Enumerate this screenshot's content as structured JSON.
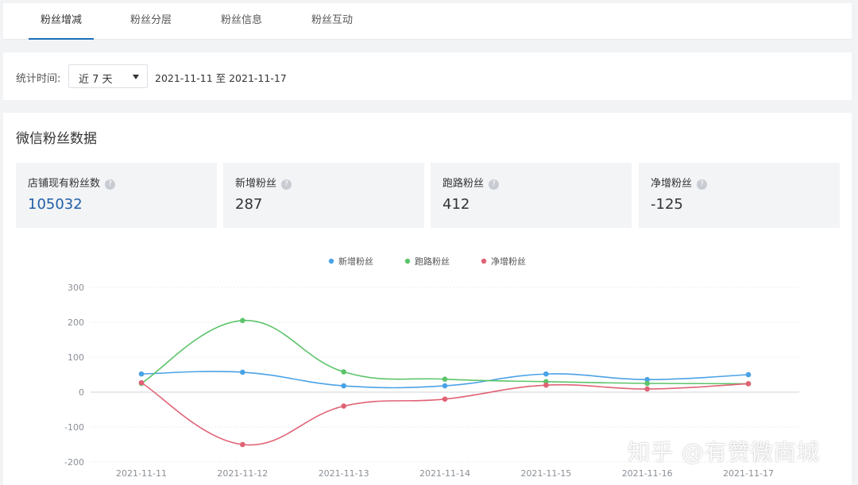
{
  "tabs": [
    {
      "label": "粉丝增减",
      "active": true
    },
    {
      "label": "粉丝分层",
      "active": false
    },
    {
      "label": "粉丝信息",
      "active": false
    },
    {
      "label": "粉丝互动",
      "active": false
    }
  ],
  "filter": {
    "label": "统计时间:",
    "period": "近 7 天",
    "date_range": "2021-11-11 至 2021-11-17"
  },
  "section": {
    "title": "微信粉丝数据"
  },
  "metrics": [
    {
      "label": "店铺现有粉丝数",
      "value": "105032"
    },
    {
      "label": "新增粉丝",
      "value": "287"
    },
    {
      "label": "跑路粉丝",
      "value": "412"
    },
    {
      "label": "净增粉丝",
      "value": "-125"
    }
  ],
  "help_icon": "?",
  "colors": {
    "accent": "#1f6fb8",
    "new": "#4aa2e6",
    "lost": "#5cc46a",
    "net": "#e06275"
  },
  "chart_data": {
    "type": "line",
    "x": [
      "2021-11-11",
      "2021-11-12",
      "2021-11-13",
      "2021-11-14",
      "2021-11-15",
      "2021-11-16",
      "2021-11-17"
    ],
    "series": [
      {
        "name": "新增粉丝",
        "color": "#4aa2e6",
        "values": [
          52,
          57,
          18,
          18,
          52,
          36,
          50
        ]
      },
      {
        "name": "跑路粉丝",
        "color": "#5cc46a",
        "values": [
          25,
          205,
          58,
          37,
          30,
          25,
          24
        ]
      },
      {
        "name": "净增粉丝",
        "color": "#e06275",
        "values": [
          27,
          -150,
          -40,
          -20,
          20,
          9,
          24
        ]
      }
    ],
    "y_ticks": [
      300,
      200,
      100,
      0,
      -100,
      -200
    ],
    "ylim": [
      -200,
      300
    ],
    "legend_position": "top-center",
    "grid": true
  },
  "watermark": "知乎 @有赞微商城"
}
